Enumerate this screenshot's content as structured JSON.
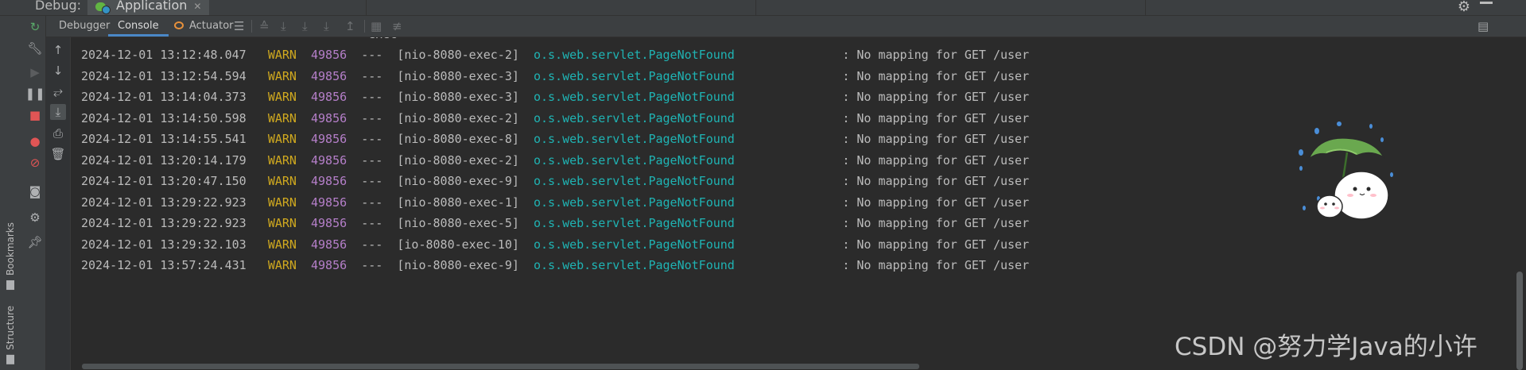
{
  "window": {
    "tool_window_label": "Debug:",
    "run_tab_label": "Application"
  },
  "toolbar": {
    "tabs": [
      {
        "label": "Debugger"
      },
      {
        "label": "Console"
      },
      {
        "label": "Actuator"
      }
    ],
    "active_tab": "Console"
  },
  "stripe": {
    "bookmarks_label": "Bookmarks",
    "structure_label": "Structure"
  },
  "console": {
    "clipped_top_line": "                                       -exec-                                                                    ",
    "lines": [
      {
        "ts": "2024-12-01 13:12:48.047",
        "level": "WARN",
        "pid": "49856",
        "sep": "---",
        "thread": "[nio-8080-exec-2]",
        "logger": "o.s.web.servlet.PageNotFound",
        "message": ": No mapping for GET /user"
      },
      {
        "ts": "2024-12-01 13:12:54.594",
        "level": "WARN",
        "pid": "49856",
        "sep": "---",
        "thread": "[nio-8080-exec-3]",
        "logger": "o.s.web.servlet.PageNotFound",
        "message": ": No mapping for GET /user"
      },
      {
        "ts": "2024-12-01 13:14:04.373",
        "level": "WARN",
        "pid": "49856",
        "sep": "---",
        "thread": "[nio-8080-exec-3]",
        "logger": "o.s.web.servlet.PageNotFound",
        "message": ": No mapping for GET /user"
      },
      {
        "ts": "2024-12-01 13:14:50.598",
        "level": "WARN",
        "pid": "49856",
        "sep": "---",
        "thread": "[nio-8080-exec-2]",
        "logger": "o.s.web.servlet.PageNotFound",
        "message": ": No mapping for GET /user"
      },
      {
        "ts": "2024-12-01 13:14:55.541",
        "level": "WARN",
        "pid": "49856",
        "sep": "---",
        "thread": "[nio-8080-exec-8]",
        "logger": "o.s.web.servlet.PageNotFound",
        "message": ": No mapping for GET /user"
      },
      {
        "ts": "2024-12-01 13:20:14.179",
        "level": "WARN",
        "pid": "49856",
        "sep": "---",
        "thread": "[nio-8080-exec-2]",
        "logger": "o.s.web.servlet.PageNotFound",
        "message": ": No mapping for GET /user"
      },
      {
        "ts": "2024-12-01 13:20:47.150",
        "level": "WARN",
        "pid": "49856",
        "sep": "---",
        "thread": "[nio-8080-exec-9]",
        "logger": "o.s.web.servlet.PageNotFound",
        "message": ": No mapping for GET /user"
      },
      {
        "ts": "2024-12-01 13:29:22.923",
        "level": "WARN",
        "pid": "49856",
        "sep": "---",
        "thread": "[nio-8080-exec-1]",
        "logger": "o.s.web.servlet.PageNotFound",
        "message": ": No mapping for GET /user"
      },
      {
        "ts": "2024-12-01 13:29:22.923",
        "level": "WARN",
        "pid": "49856",
        "sep": "---",
        "thread": "[nio-8080-exec-5]",
        "logger": "o.s.web.servlet.PageNotFound",
        "message": ": No mapping for GET /user"
      },
      {
        "ts": "2024-12-01 13:29:32.103",
        "level": "WARN",
        "pid": "49856",
        "sep": "---",
        "thread": "[io-8080-exec-10]",
        "logger": "o.s.web.servlet.PageNotFound",
        "message": ": No mapping for GET /user"
      },
      {
        "ts": "2024-12-01 13:57:24.431",
        "level": "WARN",
        "pid": "49856",
        "sep": "---",
        "thread": "[nio-8080-exec-9]",
        "logger": "o.s.web.servlet.PageNotFound",
        "message": ": No mapping for GET /user"
      }
    ]
  },
  "watermark": "CSDN @努力学Java的小许",
  "colors": {
    "background": "#2b2b2b",
    "panel": "#3c3f41",
    "warn": "#d0a91f",
    "pid": "#b57fc9",
    "logger": "#1fb3b3",
    "text": "#bbbbbb",
    "tab_underline": "#4a88c7"
  },
  "icons": {
    "topbar": [
      "application-run-icon",
      "close-icon",
      "gear-icon",
      "minimize-icon"
    ],
    "actions": [
      "rerun-icon",
      "wrench-icon",
      "resume-icon",
      "pause-icon",
      "stop-icon",
      "view-breakpoints-icon",
      "mute-breakpoints-icon",
      "camera-icon",
      "settings-icon",
      "pin-icon"
    ],
    "console_gutter": [
      "scroll-up-icon",
      "scroll-down-icon",
      "soft-wrap-icon",
      "scroll-to-end-icon",
      "print-icon",
      "trash-icon"
    ]
  }
}
